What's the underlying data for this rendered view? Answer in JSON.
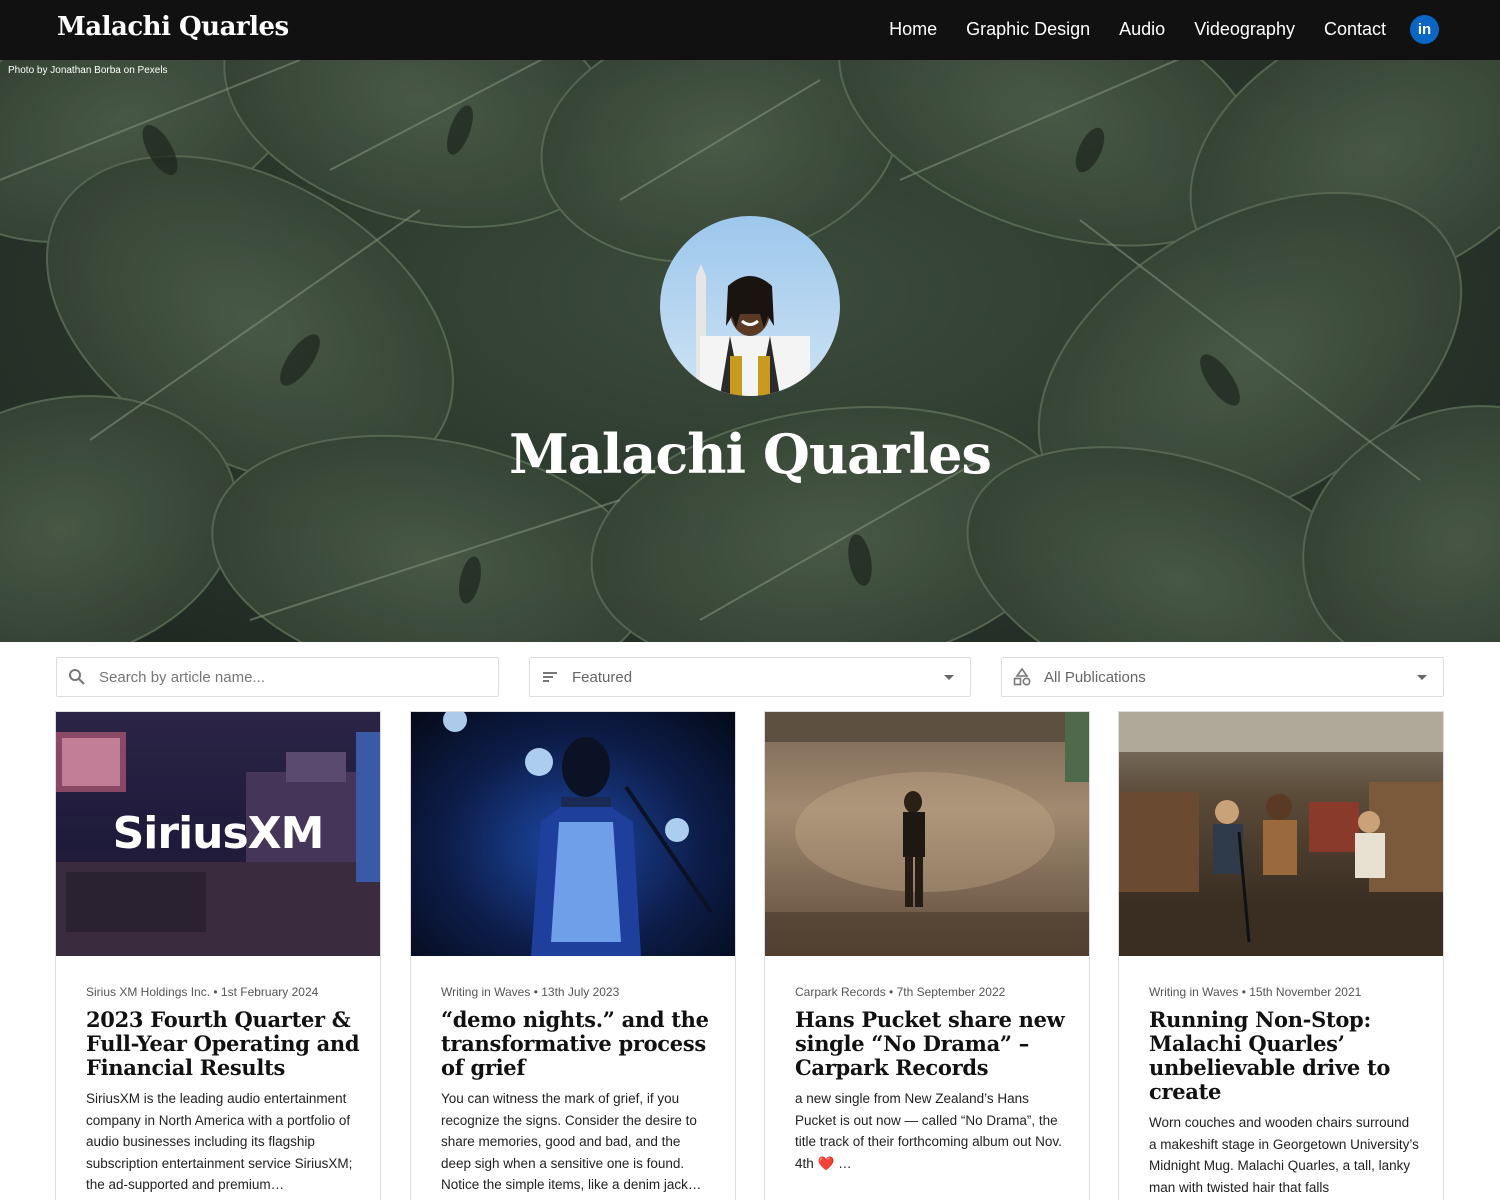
{
  "header": {
    "brand": "Malachi Quarles",
    "nav": [
      "Home",
      "Graphic Design",
      "Audio",
      "Videography",
      "Contact"
    ],
    "linkedin_label": "in"
  },
  "hero": {
    "photo_credit": "Photo by Jonathan Borba on Pexels",
    "title": "Malachi Quarles"
  },
  "filters": {
    "search_placeholder": "Search by article name...",
    "sort_value": "Featured",
    "publication_value": "All Publications"
  },
  "cards": [
    {
      "meta": "Sirius XM Holdings Inc. • 1st February 2024",
      "title": "2023 Fourth Quarter & Full-Year Operating and Financial Results",
      "excerpt": "SiriusXM is the leading audio entertainment company in North America with a portfolio of audio businesses including its flagship subscription entertainment service SiriusXM; the ad-supported and premium…",
      "image_text": "SiriusXM"
    },
    {
      "meta": "Writing in Waves • 13th July 2023",
      "title": "“demo nights.” and the transformative process of grief",
      "excerpt": "You can witness the mark of grief, if you recognize the signs. Consider the desire to share memories, good and bad, and the deep sigh when a sensitive one is found. Notice the simple items, like a denim jack…"
    },
    {
      "meta": "Carpark Records • 7th September 2022",
      "title": "Hans Pucket share new single “No Drama” – Carpark Records",
      "excerpt": "a new single from New Zealand’s Hans Pucket is out now — called “No Drama”, the title track of their forthcoming album out Nov. 4th ❤️ …"
    },
    {
      "meta": "Writing in Waves • 15th November 2021",
      "title": "Running Non-Stop: Malachi Quarles’ unbelievable drive to create",
      "excerpt": "Worn couches and wooden chairs surround a makeshift stage in Georgetown University’s Midnight Mug. Malachi Quarles, a tall, lanky man with twisted hair that falls"
    }
  ],
  "icons": {
    "search": "search-icon",
    "sort": "sort-icon",
    "publications": "shapes-icon",
    "linkedin": "linkedin-icon"
  }
}
